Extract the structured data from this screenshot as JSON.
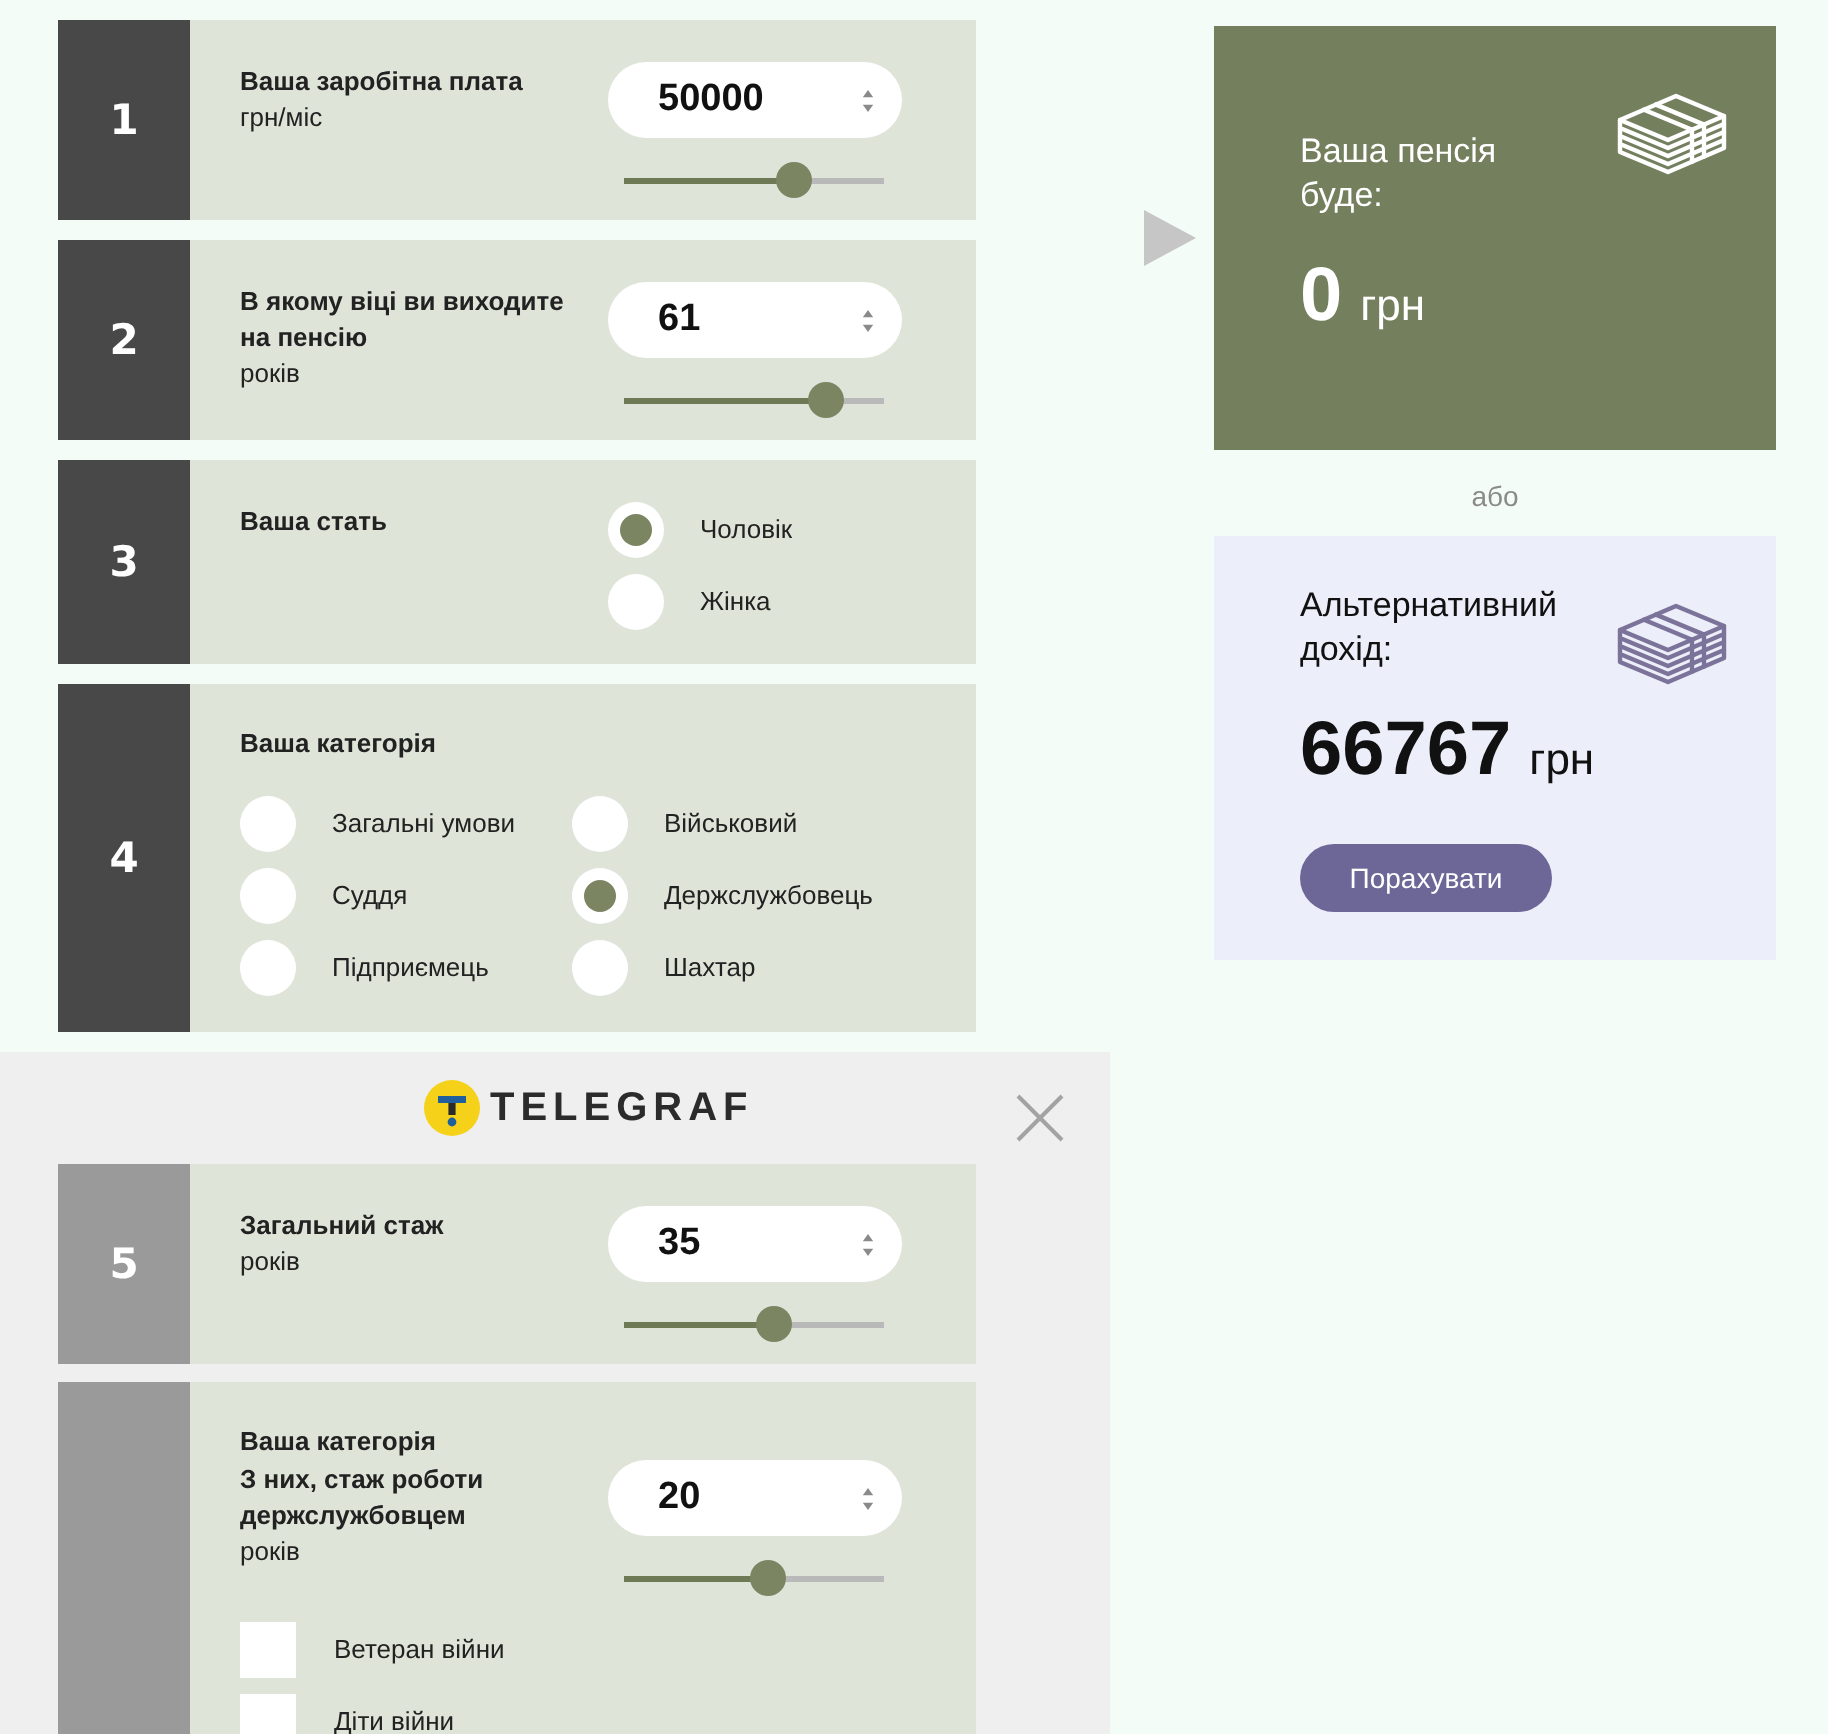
{
  "steps": [
    {
      "kind": "number",
      "number": "1",
      "label": "Ваша заробітна плата",
      "unit": "грн/міс",
      "value": "50000",
      "level": 0.65
    },
    {
      "kind": "number",
      "number": "2",
      "label": "В якому віці ви виходите на пенсію",
      "unit": "років",
      "value": "61",
      "level": 0.78
    },
    {
      "kind": "choice",
      "number": "3",
      "label": "Ваша стать",
      "options": [
        {
          "label": "Чоловік",
          "selected": true
        },
        {
          "label": "Жінка",
          "selected": false
        }
      ]
    },
    {
      "kind": "choice-grid",
      "number": "4",
      "title": "Ваша категорія",
      "options": [
        {
          "label": "Загальні умови",
          "selected": false
        },
        {
          "label": "Військовий",
          "selected": false
        },
        {
          "label": "Суддя",
          "selected": false
        },
        {
          "label": "Держслужбовець",
          "selected": true
        },
        {
          "label": "Підприємець",
          "selected": false
        },
        {
          "label": "Шахтар",
          "selected": false
        }
      ]
    }
  ],
  "overlay": {
    "logo": "TELEGRAF",
    "steps": [
      {
        "kind": "number",
        "number": "5",
        "label": "Загальний стаж",
        "unit": "років",
        "value": "35",
        "level": 0.58
      },
      {
        "kind": "number",
        "title": "Ваша категорія",
        "label": "З них, стаж роботи держслужбовцем",
        "unit": "років",
        "value": "20",
        "level": 0.55,
        "checks": [
          {
            "label": "Ветеран війни",
            "checked": false
          },
          {
            "label": "Діти війни",
            "checked": false
          }
        ]
      }
    ]
  },
  "result": {
    "title": "Ваша пенсія буде:",
    "amount": "0",
    "currency": "грн"
  },
  "separator": "або",
  "alternative": {
    "title": "Альтернативний дохід:",
    "amount": "66767",
    "currency": "грн",
    "button": "Порахувати"
  }
}
